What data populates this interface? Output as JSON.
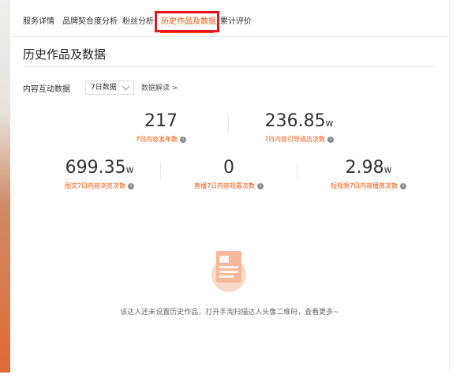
{
  "tabs": [
    {
      "label": "服务详情",
      "active": false
    },
    {
      "label": "品牌契合度分析",
      "active": false
    },
    {
      "label": "粉丝分析",
      "active": false
    },
    {
      "label": "历史作品及数据",
      "active": true
    },
    {
      "label": "累计评价",
      "active": false
    }
  ],
  "section": {
    "title": "历史作品及数据"
  },
  "filter": {
    "label": "内容互动数据",
    "period": "7日数据",
    "interpret_link": "数据解读 >"
  },
  "stats_row1": [
    {
      "value": "217",
      "unit": "",
      "label": "7日内容发布数"
    },
    {
      "value": "236.85",
      "unit": "w",
      "label": "7日内容引导进店次数"
    }
  ],
  "stats_row2": [
    {
      "value": "699.35",
      "unit": "w",
      "label": "图文7日内容浏览次数"
    },
    {
      "value": "0",
      "unit": "",
      "label": "直播7日内容观看次数"
    },
    {
      "value": "2.98",
      "unit": "w",
      "label": "短视频7日内容播放次数"
    }
  ],
  "empty_state": {
    "message": "该达人还未设置历史作品，打开手淘扫描达人头像二维码，查看更多~"
  },
  "colors": {
    "accent": "#ff5000",
    "highlight_box": "#e8161b"
  }
}
